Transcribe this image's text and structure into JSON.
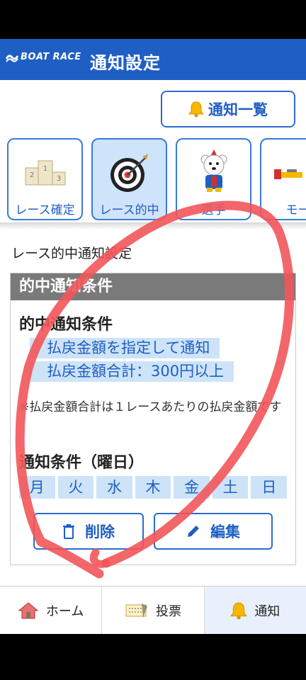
{
  "header": {
    "logo_text": "BOAT RACE",
    "title": "通知設定",
    "color": "#1f5fc4"
  },
  "notify_list": {
    "label": "通知一覧",
    "icon": "bell-icon"
  },
  "tabs": [
    {
      "label": "レース確定",
      "icon": "podium-icon",
      "active": false
    },
    {
      "label": "レース的中",
      "icon": "target-icon",
      "active": true
    },
    {
      "label": "選手",
      "icon": "bear-mascot-icon",
      "active": false
    },
    {
      "label": "モー",
      "icon": "motor-icon",
      "active": false
    }
  ],
  "section_title": "レース的中通知設定",
  "card": {
    "header": "的中通知条件",
    "condition_heading": "的中通知条件",
    "condition_lines": [
      "払戻金額を指定して通知",
      "払戻金額合計：300円以上"
    ],
    "note": "※払戻金額合計は１レースあたりの払戻金額です",
    "weekday_heading": "通知条件（曜日）",
    "weekdays": [
      "月",
      "火",
      "水",
      "木",
      "金",
      "土",
      "日"
    ],
    "delete_label": "削除",
    "edit_label": "編集"
  },
  "bottom_nav": [
    {
      "label": "ホーム",
      "icon": "home-icon"
    },
    {
      "label": "投票",
      "icon": "ticket-icon"
    },
    {
      "label": "通知",
      "icon": "bell-icon",
      "active": true
    }
  ],
  "annotation_color": "#f2555a"
}
